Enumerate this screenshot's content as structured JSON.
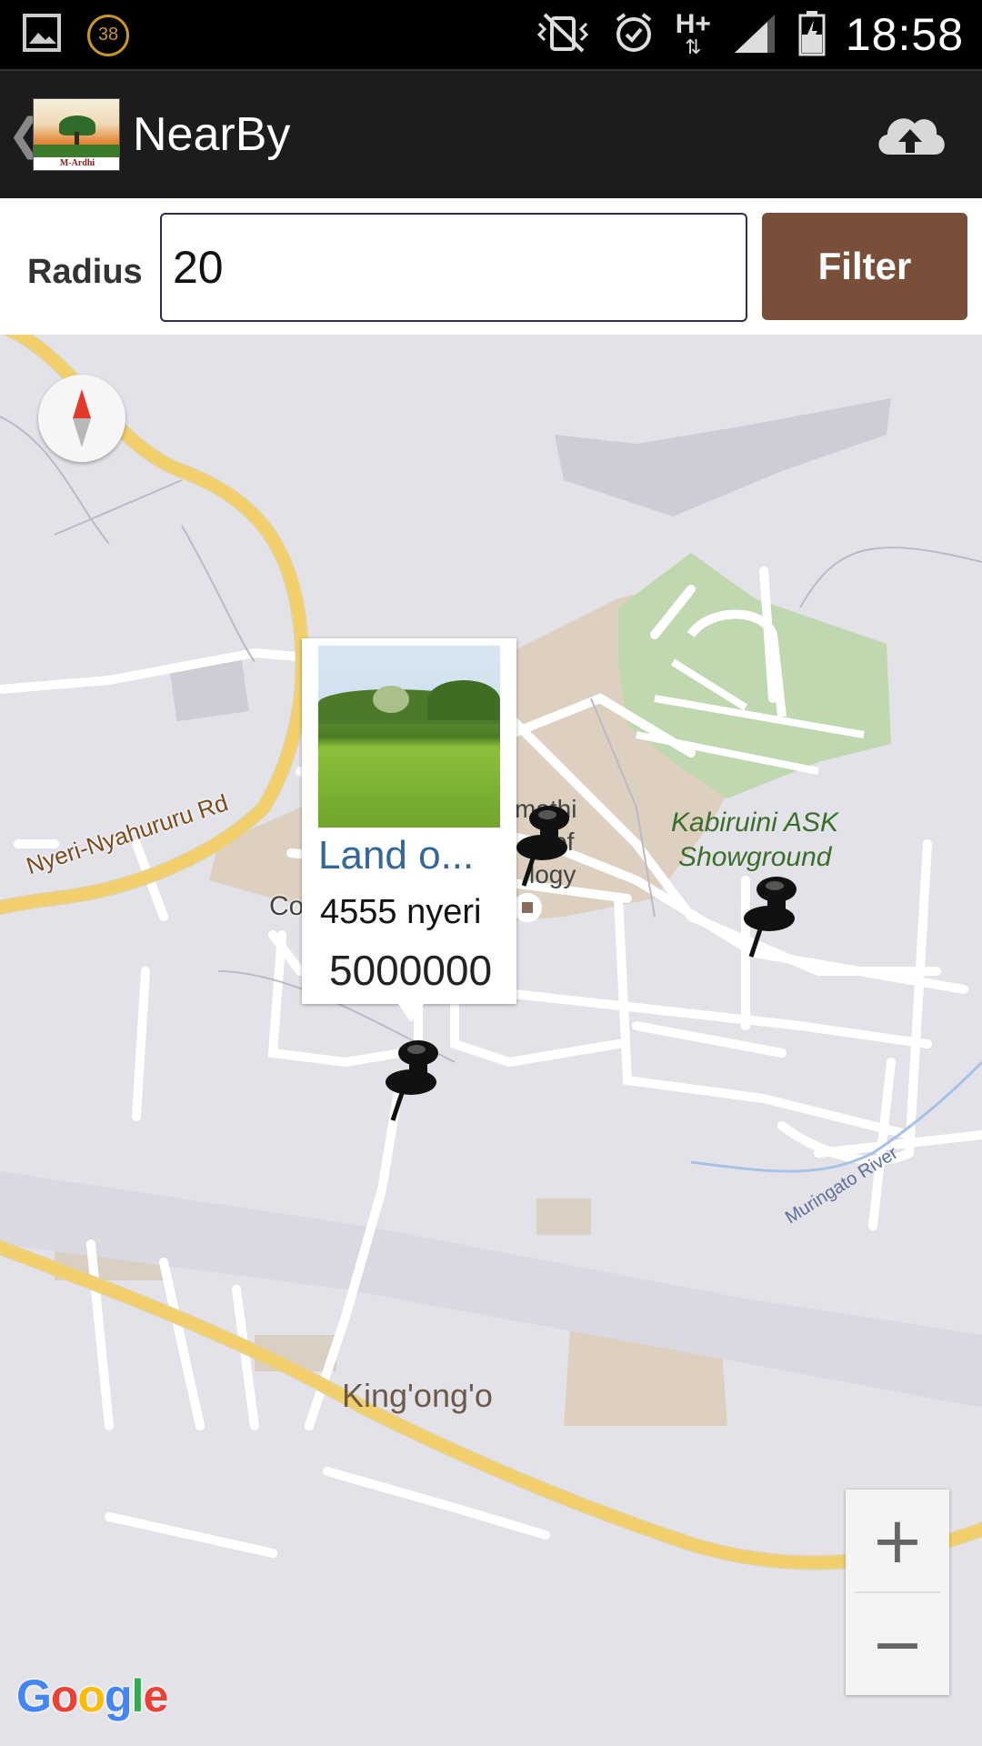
{
  "status_bar": {
    "notification_badge": "38",
    "network_type": "H+",
    "time": "18:58"
  },
  "action_bar": {
    "title": "NearBy",
    "logo_text": "M-Ardhi",
    "upload_icon": "cloud-upload-icon"
  },
  "filter": {
    "radius_label": "Radius",
    "radius_value": "20",
    "filter_button_label": "Filter"
  },
  "map": {
    "labels": {
      "road_nyeri_nyahururu": "Nyeri-Nyahururu Rd",
      "coffee_plantation": "Coffee Plantation",
      "kabiruini_line1": "Kabiruini ASK",
      "kabiruini_line2": "Showground",
      "dedan_line1": "mathi",
      "dedan_line2": "of",
      "dedan_line3": "logy",
      "kingongo": "King'ong'o",
      "muringato_river": "Muringato River"
    },
    "info_window": {
      "title": "Land o...",
      "description": "4555 nyeri",
      "price": "5000000"
    },
    "zoom_in": "+",
    "zoom_out": "−",
    "attribution": "Google",
    "colors": {
      "background": "#e4e2e9",
      "major_road": "#f2cf6a",
      "minor_road": "#ffffff",
      "urban_area": "#ddd0c0",
      "park": "#bfd8b0",
      "park_label": "#3a6e2a",
      "link": "#336699",
      "filter_button": "#7a4f3a"
    }
  }
}
